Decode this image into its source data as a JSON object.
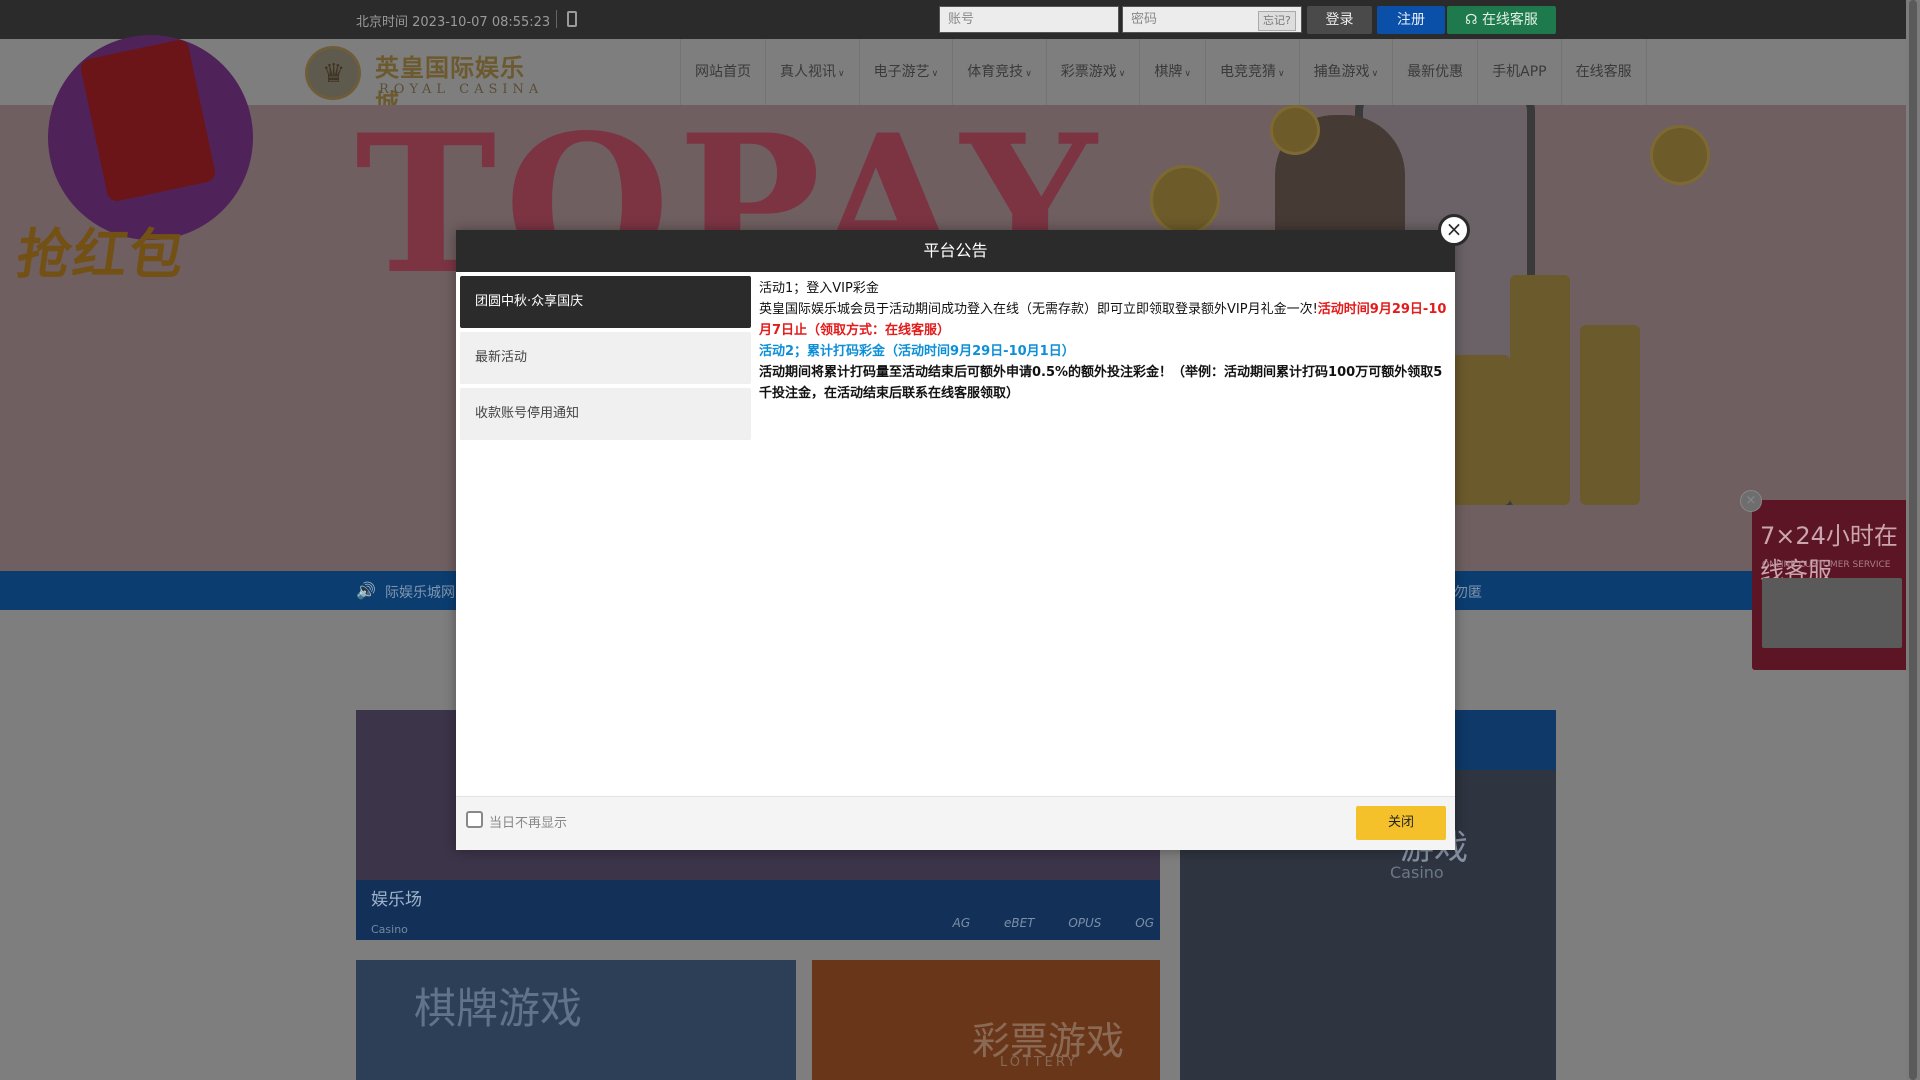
{
  "topbar": {
    "clock": "北京时间 2023-10-07 08:55:23",
    "account_placeholder": "账号",
    "password_placeholder": "密码",
    "forgot_label": "忘记?",
    "login_label": "登录",
    "register_label": "注册",
    "service_label": "在线客服"
  },
  "logo": {
    "cn": "英皇国际娱乐城",
    "en": "ROYAL CASINA"
  },
  "nav": [
    {
      "label": "网站首页",
      "dropdown": false
    },
    {
      "label": "真人视讯",
      "dropdown": true
    },
    {
      "label": "电子游艺",
      "dropdown": true
    },
    {
      "label": "体育竞技",
      "dropdown": true
    },
    {
      "label": "彩票游戏",
      "dropdown": true
    },
    {
      "label": "棋牌",
      "dropdown": true
    },
    {
      "label": "电竞竞猜",
      "dropdown": true
    },
    {
      "label": "捕鱼游戏",
      "dropdown": true
    },
    {
      "label": "最新优惠",
      "dropdown": false
    },
    {
      "label": "手机APP",
      "dropdown": false
    },
    {
      "label": "在线客服",
      "dropdown": false
    }
  ],
  "banner": {
    "word": "TOPAY"
  },
  "hongbao": {
    "text": "抢红包"
  },
  "notice": {
    "left_text": "际娱乐城网",
    "right_text": "全，请勿匿"
  },
  "cards": {
    "casino_title": "娱乐场",
    "casino_sub": "Casino",
    "providers": [
      "AG",
      "eBET",
      "OPUS",
      "OG"
    ],
    "right_title": "游戏",
    "right_sub": "Casino",
    "qipai_title": "棋牌游戏",
    "lottery_title": "彩票游戏",
    "lottery_sub": "LOTTERY"
  },
  "float_service": {
    "title": "7×24小时在线客服",
    "subtitle": "ONLINE CUSTOMER SERVICE"
  },
  "modal": {
    "title": "平台公告",
    "tabs": [
      {
        "label": "团圆中秋·众享国庆",
        "active": true
      },
      {
        "label": "最新活动",
        "active": false
      },
      {
        "label": "收款账号停用通知",
        "active": false
      }
    ],
    "content": {
      "line1": "活动1；登入VIP彩金",
      "line2_normal": "英皇国际娱乐城会员于活动期间成功登入在线（无需存款）即可立即领取登录额外VIP月礼金一次!",
      "line2_red": "活动时间9月29日-10月7日止（领取方式：在线客服）",
      "line3_blue": "活动2；累计打码彩金（活动时间9月29日-10月1日）",
      "line4_bold": "活动期间将累计打码量至活动结束后可额外申请0.5%的额外投注彩金！（举例：活动期间累计打码100万可额外领取5千投注金，在活动结束后联系在线客服领取）"
    },
    "dont_show_label": "当日不再显示",
    "close_label": "关闭"
  }
}
